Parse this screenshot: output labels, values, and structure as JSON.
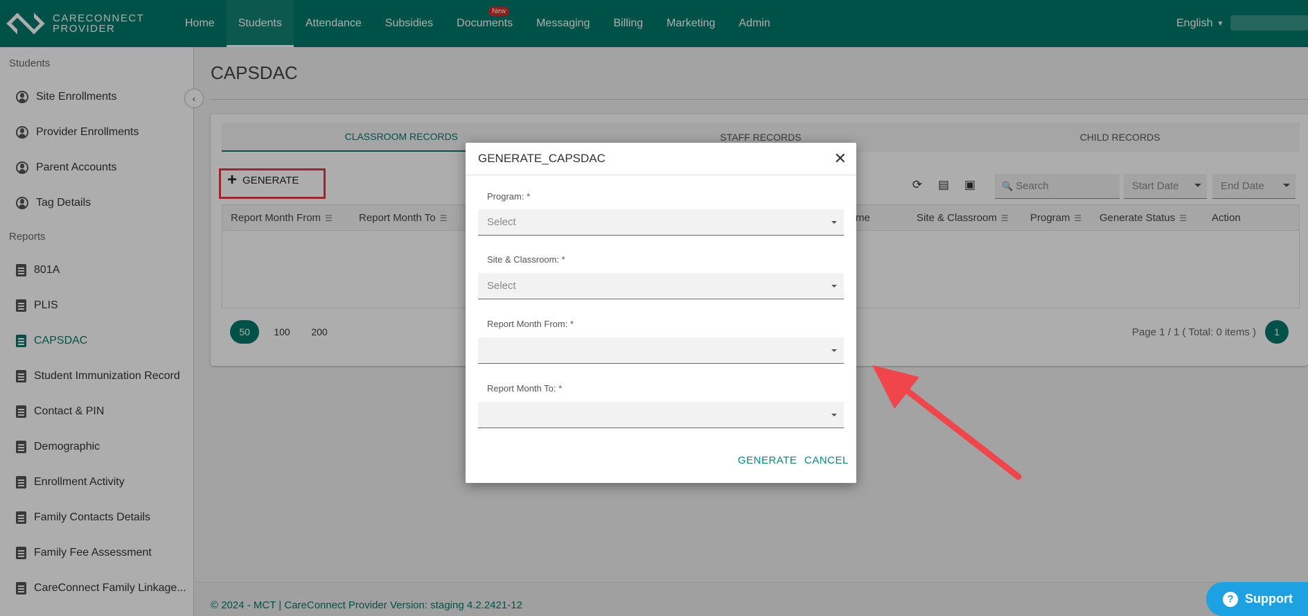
{
  "brand": {
    "line1": "CARECONNECT",
    "line2": "PROVIDER"
  },
  "nav": {
    "items": [
      {
        "label": "Home"
      },
      {
        "label": "Students",
        "active": true
      },
      {
        "label": "Attendance"
      },
      {
        "label": "Subsidies"
      },
      {
        "label": "Documents",
        "badge": "New"
      },
      {
        "label": "Messaging"
      },
      {
        "label": "Billing"
      },
      {
        "label": "Marketing"
      },
      {
        "label": "Admin"
      }
    ],
    "language": "English"
  },
  "sidebar": {
    "students_section": "Students",
    "students_items": [
      {
        "label": "Site Enrollments"
      },
      {
        "label": "Provider Enrollments"
      },
      {
        "label": "Parent Accounts"
      },
      {
        "label": "Tag Details"
      }
    ],
    "reports_section": "Reports",
    "reports_items": [
      {
        "label": "801A"
      },
      {
        "label": "PLIS"
      },
      {
        "label": "CAPSDAC",
        "active": true
      },
      {
        "label": "Student Immunization Record"
      },
      {
        "label": "Contact & PIN"
      },
      {
        "label": "Demographic"
      },
      {
        "label": "Enrollment Activity"
      },
      {
        "label": "Family Contacts Details"
      },
      {
        "label": "Family Fee Assessment"
      },
      {
        "label": "CareConnect Family Linkage..."
      }
    ]
  },
  "page": {
    "title": "CAPSDAC",
    "tabs": [
      {
        "label": "CLASSROOM RECORDS",
        "active": true
      },
      {
        "label": "STAFF RECORDS"
      },
      {
        "label": "CHILD RECORDS"
      }
    ],
    "generate_label": "GENERATE",
    "search_placeholder": "Search",
    "start_date": "Start Date",
    "end_date": "End Date",
    "columns": [
      "Report Month From",
      "Report Month To",
      "me",
      "Site & Classroom",
      "Program",
      "Generate Status",
      "Action"
    ],
    "page_sizes": [
      "50",
      "100",
      "200"
    ],
    "page_info": "Page 1 / 1 ( Total: 0 items )",
    "current_page": "1"
  },
  "footer": {
    "text": "© 2024 - MCT | CareConnect Provider Version: staging 4.2.2421-12"
  },
  "support": {
    "label": "Support"
  },
  "modal": {
    "title": "GENERATE_CAPSDAC",
    "fields": [
      {
        "label": "Program: *",
        "placeholder": "Select"
      },
      {
        "label": "Site & Classroom: *",
        "placeholder": "Select"
      },
      {
        "label": "Report Month From: *",
        "placeholder": ""
      },
      {
        "label": "Report Month To: *",
        "placeholder": ""
      }
    ],
    "generate_button": "GENERATE",
    "cancel_button": "CANCEL"
  },
  "colors": {
    "brand": "#00796b",
    "annotation": "#e53935",
    "support": "#1da1e2"
  }
}
